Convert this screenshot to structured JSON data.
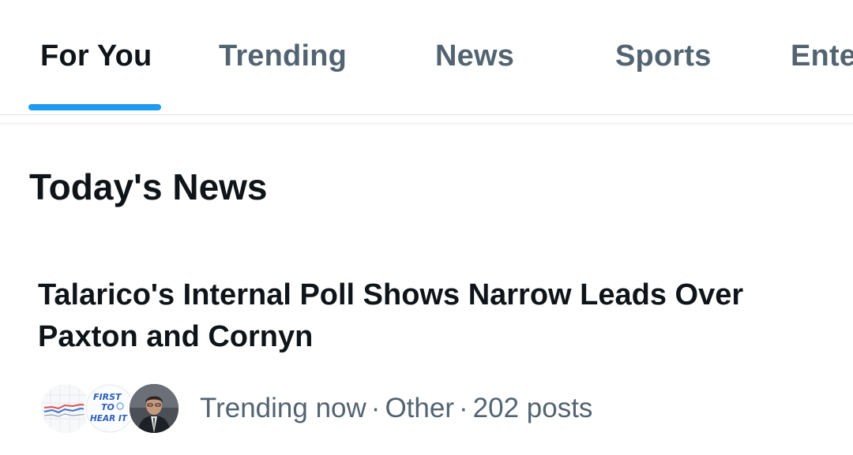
{
  "tabs": [
    {
      "label": "For You",
      "active": true
    },
    {
      "label": "Trending",
      "active": false
    },
    {
      "label": "News",
      "active": false
    },
    {
      "label": "Sports",
      "active": false
    },
    {
      "label": "Ente",
      "active": false
    }
  ],
  "section": {
    "title": "Today's News"
  },
  "news_item": {
    "headline": "Talarico's Internal Poll Shows Narrow Leads Over Paxton and Cornyn",
    "meta": {
      "status": "Trending now",
      "category": "Other",
      "posts": "202 posts",
      "separator": "·"
    },
    "avatars": [
      {
        "icon": "line-chart-thumbnail"
      },
      {
        "icon": "first-to-hear-it-logo",
        "text": [
          "FIRST",
          "TO",
          "HEAR IT"
        ]
      },
      {
        "icon": "person-photo"
      }
    ]
  },
  "colors": {
    "accent": "#1d9bf0",
    "text_primary": "#0f1419",
    "text_secondary": "#536471",
    "divider": "#dfe3e6"
  }
}
